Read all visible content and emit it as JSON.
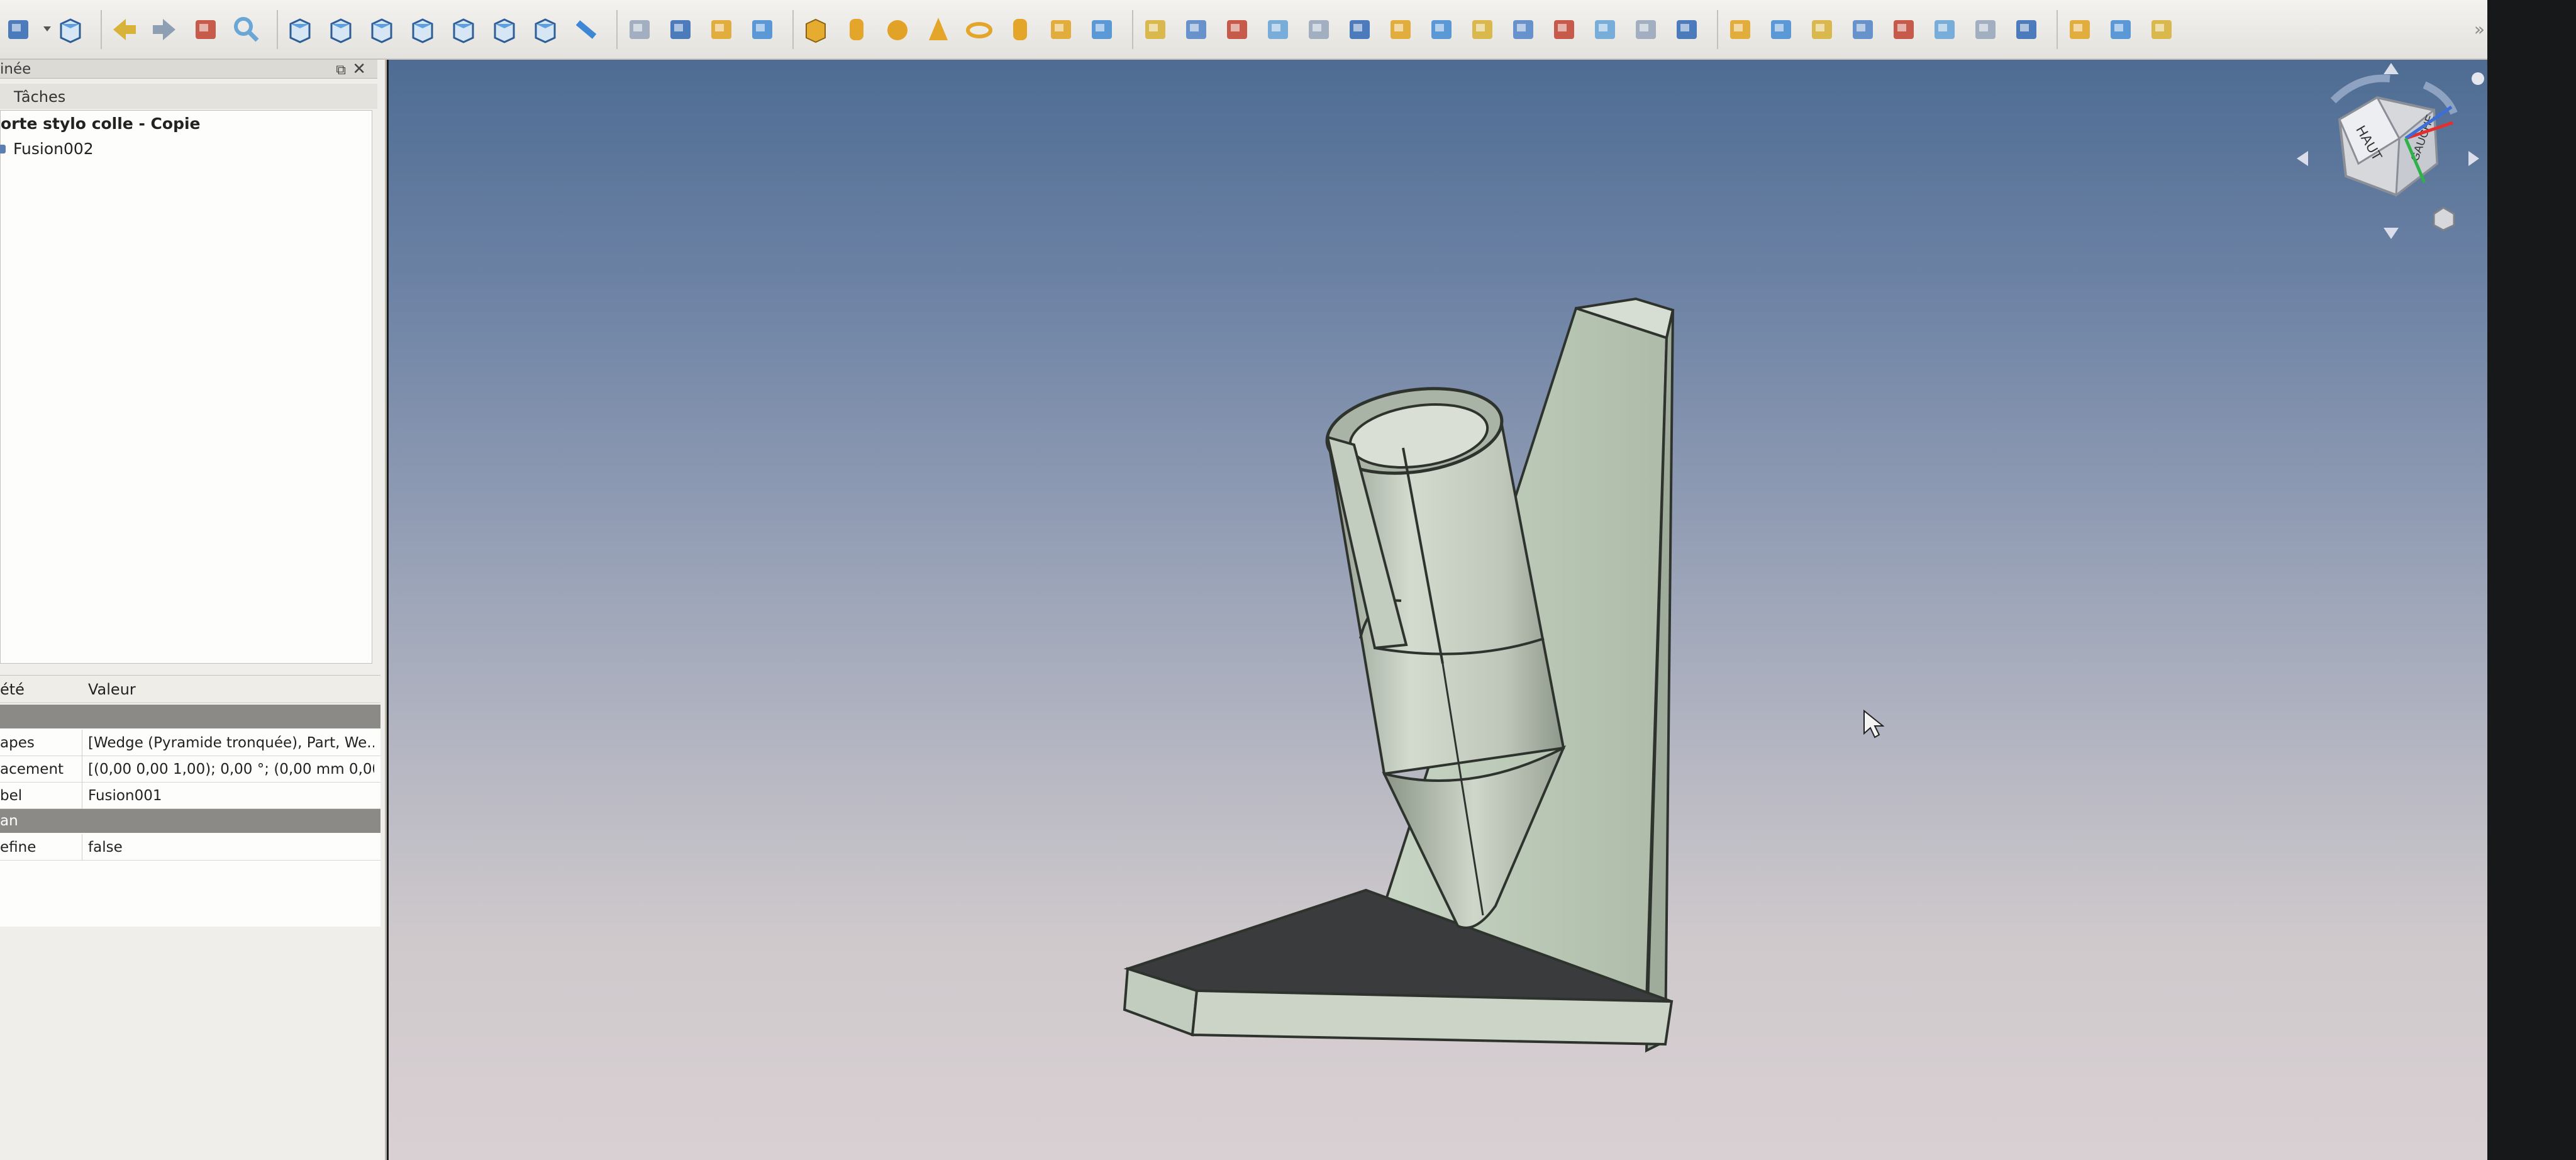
{
  "panel": {
    "title": "inée",
    "float_icon": "float-icon",
    "close_icon": "close-icon",
    "tabs": [
      "Tâches"
    ],
    "tree": {
      "root": "orte stylo colle - Copie",
      "children": [
        "Fusion002"
      ]
    },
    "properties": {
      "headers": [
        "été",
        "Valeur"
      ],
      "rows": [
        {
          "type": "group",
          "label": ""
        },
        {
          "type": "prop",
          "key": "apes",
          "value": "[Wedge (Pyramide tronquée), Part, We..."
        },
        {
          "type": "prop",
          "key": "acement",
          "value": "[(0,00 0,00 1,00); 0,00 °; (0,00 mm  0,00 ..."
        },
        {
          "type": "prop",
          "key": "bel",
          "value": "Fusion001"
        },
        {
          "type": "group",
          "label": "an"
        },
        {
          "type": "prop",
          "key": "efine",
          "value": "false"
        }
      ]
    }
  },
  "toolbar": {
    "icons": [
      "part-workbench-icon",
      "dropdown-icon",
      "std-view-icon",
      "back-arrow-icon",
      "forward-arrow-icon",
      "macro-icon",
      "zoom-icon",
      "isometric-view-icon",
      "front-view-icon",
      "top-view-icon",
      "right-view-icon",
      "rear-view-icon",
      "bottom-view-icon",
      "left-view-icon",
      "measure-icon",
      "part-icon",
      "group-icon",
      "link-icon",
      "link-sub-icon",
      "box-icon",
      "cylinder-icon",
      "sphere-icon",
      "cone-icon",
      "torus-icon",
      "tube-icon",
      "primitives-icon",
      "shape-builder-icon",
      "extrude-icon",
      "revolve-icon",
      "mirror-icon",
      "fillet-icon",
      "chamfer-icon",
      "make-face-icon",
      "ruled-surface-icon",
      "loft-icon",
      "sweep-icon",
      "section-icon",
      "cross-section-icon",
      "offset-icon",
      "thickness-icon",
      "projection-icon",
      "boolean-icon",
      "cut-icon",
      "union-icon",
      "intersect-icon",
      "join-icon",
      "split-icon",
      "compound-icon",
      "check-geometry-icon",
      "defeaturing-icon",
      "attachment-icon",
      "color-icon"
    ]
  },
  "viewport": {
    "navcube": {
      "faces": [
        "HAUT",
        "GAUCHE"
      ]
    }
  }
}
